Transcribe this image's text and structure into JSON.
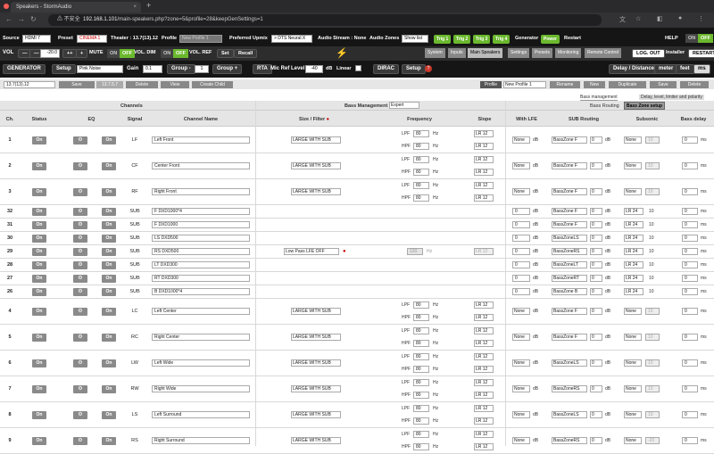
{
  "browser": {
    "tab_title": "Speakers - StormAudio",
    "insecure": "不安全",
    "url_host": "192.168.1.101",
    "url_path": "/main-speakers.php?zone=5&profile=28&keepGenSettings=1"
  },
  "top": {
    "source_label": "Source",
    "source_value": "HDMI 7",
    "preset_label": "Preset",
    "preset_value": "CINEMA 1",
    "theater_label": "Theater : 13.7(13).12",
    "profile_label": "Profile",
    "profile_value": "New Profile 1",
    "upmix_label": "Preferred Upmix",
    "upmix_value": "> DTS Neural:X",
    "audio_stream": "Audio Stream : None",
    "zones_label": "Audio Zones",
    "zones_value": "Show list",
    "trig": [
      "Trig 1",
      "Trig 2",
      "Trig 3",
      "Trig 4"
    ],
    "generator": "Generator",
    "power": "Power",
    "restart": "Restart",
    "help": "HELP",
    "on": "ON",
    "off": "OFF"
  },
  "vol": {
    "vol_label": "VOL",
    "minus2": "—",
    "minus1": "—",
    "value": "-20.0",
    "plus2": "++",
    "plus1": "+",
    "mute": "MUTE",
    "on": "ON",
    "off": "OFF",
    "dim": "VOL. DIM",
    "ref": "VOL. REF",
    "set": "Set",
    "recall": "Recall"
  },
  "nav": {
    "tabs": [
      "System",
      "Inputs",
      "Main Speakers",
      "Settings",
      "Presets",
      "Monitoring",
      "Remote Control"
    ],
    "active": 2,
    "logout": "LOG. OUT",
    "installer": "Installer",
    "restart": "RESTART"
  },
  "gen": {
    "generator": "GENERATOR",
    "setup": "Setup",
    "noise": "Pink Noise",
    "gain_label": "Gain",
    "gain": "0.1",
    "group_minus": "Group -",
    "group": "1",
    "group_plus": "Group +",
    "rta": "RTA",
    "mic_label": "Mic Ref Level",
    "mic": "-40",
    "db": "dB",
    "linear": "Linear",
    "dirac": "DIRAC",
    "dirac_setup": "Setup",
    "delay": "Delay / Distance",
    "meter": "meter",
    "feet": "feet",
    "ms": "ms"
  },
  "layout": {
    "name": "13.7(13).12",
    "save": "Save",
    "id": "13.7.5.7",
    "delete": "Delete",
    "view": "View",
    "child": "Create Child",
    "profile_label": "Profile",
    "profile": "New Profile 1",
    "rename": "Rename",
    "new": "New",
    "duplicate": "Duplicate",
    "psave": "Save",
    "pdelete": "Delete"
  },
  "bass": {
    "mgmt_tab": "Bass management",
    "delay_tab": "Delay, level, limiter and polarity",
    "routing_label": "Bass Routing",
    "zone_setup": "Bass Zone setup"
  },
  "headers": {
    "channels": "Channels",
    "bass_mgmt": "Bass Management",
    "bass_mode": "Expert",
    "ch": "Ch.",
    "status": "Status",
    "eq": "EQ",
    "signal": "Signal",
    "name": "Channel Name",
    "size": "Size / Filter",
    "freq": "Frequency",
    "slope": "Slope",
    "with_lfe": "With LFE",
    "sub_routing": "SUB Routing",
    "subsonic": "Subsonic",
    "delay": "Bass delay"
  },
  "rows": [
    {
      "ch": "1",
      "sig": "LF",
      "name": "Left Front",
      "size": "LARGE WITH SUB",
      "lpf": "80",
      "hpf": "80",
      "sl1": "LR 12",
      "sl2": "LR 12",
      "lfe": "None",
      "route": "BassZone F",
      "rdb": "0",
      "sub": "None",
      "subv": "10",
      "delay": "0",
      "type": "spk"
    },
    {
      "ch": "2",
      "sig": "CF",
      "name": "Center Front",
      "size": "LARGE WITH SUB",
      "lpf": "80",
      "hpf": "80",
      "sl1": "LR 12",
      "sl2": "LR 12",
      "lfe": "None",
      "route": "BassZone F",
      "rdb": "0",
      "sub": "None",
      "subv": "10",
      "delay": "0",
      "type": "spk"
    },
    {
      "ch": "3",
      "sig": "RF",
      "name": "Right Front",
      "size": "LARGE WITH SUB",
      "lpf": "80",
      "hpf": "80",
      "sl1": "LR 12",
      "sl2": "LR 12",
      "lfe": "None",
      "route": "BassZone F",
      "rdb": "0",
      "sub": "None",
      "subv": "10",
      "delay": "0",
      "type": "spk"
    },
    {
      "ch": "32",
      "sig": "SUB",
      "name": "F DXD1000*4",
      "lfe": "0",
      "route": "BassZone F",
      "rdb": "0",
      "sub": "LR 24",
      "subv": "10",
      "delay": "0",
      "type": "sub"
    },
    {
      "ch": "31",
      "sig": "SUB",
      "name": "F DXD1000",
      "lfe": "0",
      "route": "BassZone F",
      "rdb": "0",
      "sub": "LR 24",
      "subv": "10",
      "delay": "0",
      "type": "sub"
    },
    {
      "ch": "30",
      "sig": "SUB",
      "name": "LS DXD500",
      "lfe": "0",
      "route": "BassZoneLS",
      "rdb": "0",
      "sub": "LR 24",
      "subv": "10",
      "delay": "0",
      "type": "sub"
    },
    {
      "ch": "29",
      "sig": "SUB",
      "name": "RS DXD500",
      "lfe": "0",
      "route": "BassZoneRS",
      "rdb": "0",
      "sub": "LR 24",
      "subv": "10",
      "delay": "0",
      "type": "sub"
    },
    {
      "ch": "28",
      "sig": "SUB",
      "name": "LT DXD300",
      "lfe": "0",
      "route": "BassZoneLT",
      "rdb": "0",
      "sub": "LR 24",
      "subv": "10",
      "delay": "0",
      "type": "sub"
    },
    {
      "ch": "27",
      "sig": "SUB",
      "name": "RT DXD300",
      "lfe": "0",
      "route": "BassZoneRT",
      "rdb": "0",
      "sub": "LR 24",
      "subv": "10",
      "delay": "0",
      "type": "sub"
    },
    {
      "ch": "26",
      "sig": "SUB",
      "name": "B DXD1000*4",
      "lfe": "0",
      "route": "BassZone B",
      "rdb": "0",
      "sub": "LR 24",
      "subv": "10",
      "delay": "0",
      "type": "sub"
    },
    {
      "ch": "4",
      "sig": "LC",
      "name": "Left Center",
      "size": "LARGE WITH SUB",
      "lpf": "80",
      "hpf": "80",
      "sl1": "LR 12",
      "sl2": "LR 12",
      "lfe": "None",
      "route": "BassZone F",
      "rdb": "0",
      "sub": "None",
      "subv": "10",
      "delay": "0",
      "type": "spk"
    },
    {
      "ch": "5",
      "sig": "RC",
      "name": "Right Center",
      "size": "LARGE WITH SUB",
      "lpf": "80",
      "hpf": "80",
      "sl1": "LR 12",
      "sl2": "LR 12",
      "lfe": "None",
      "route": "BassZone F",
      "rdb": "0",
      "sub": "None",
      "subv": "10",
      "delay": "0",
      "type": "spk"
    },
    {
      "ch": "6",
      "sig": "LW",
      "name": "Left Wide",
      "size": "LARGE WITH SUB",
      "lpf": "80",
      "hpf": "80",
      "sl1": "LR 12",
      "sl2": "LR 12",
      "lfe": "None",
      "route": "BassZoneLS",
      "rdb": "0",
      "sub": "None",
      "subv": "10",
      "delay": "0",
      "type": "spk"
    },
    {
      "ch": "7",
      "sig": "RW",
      "name": "Right Wide",
      "size": "LARGE WITH SUB",
      "lpf": "80",
      "hpf": "80",
      "sl1": "LR 12",
      "sl2": "LR 12",
      "lfe": "None",
      "route": "BassZoneRS",
      "rdb": "0",
      "sub": "None",
      "subv": "10",
      "delay": "0",
      "type": "spk"
    },
    {
      "ch": "8",
      "sig": "LS",
      "name": "Left Surround",
      "size": "LARGE WITH SUB",
      "lpf": "80",
      "hpf": "80",
      "sl1": "LR 12",
      "sl2": "LR 12",
      "lfe": "None",
      "route": "BassZoneLS",
      "rdb": "0",
      "sub": "None",
      "subv": "10",
      "delay": "0",
      "type": "spk"
    },
    {
      "ch": "9",
      "sig": "RS",
      "name": "Right Surround",
      "size": "LARGE WITH SUB",
      "lpf": "80",
      "hpf": "80",
      "sl1": "LR 12",
      "sl2": "LR 12",
      "lfe": "None",
      "route": "BassZoneRS",
      "rdb": "0",
      "sub": "None",
      "subv": "-20",
      "delay": "0",
      "type": "spk"
    }
  ],
  "subgroup": {
    "size": "Low Pass LFE OFF",
    "freq": "120",
    "hz": "Hz",
    "slope": "LR 12"
  },
  "units": {
    "lpf": "LPF",
    "hpf": "HPF",
    "hz": "Hz",
    "db": "dB",
    "ms": "ms",
    "on": "On",
    "gear": "⚙"
  }
}
